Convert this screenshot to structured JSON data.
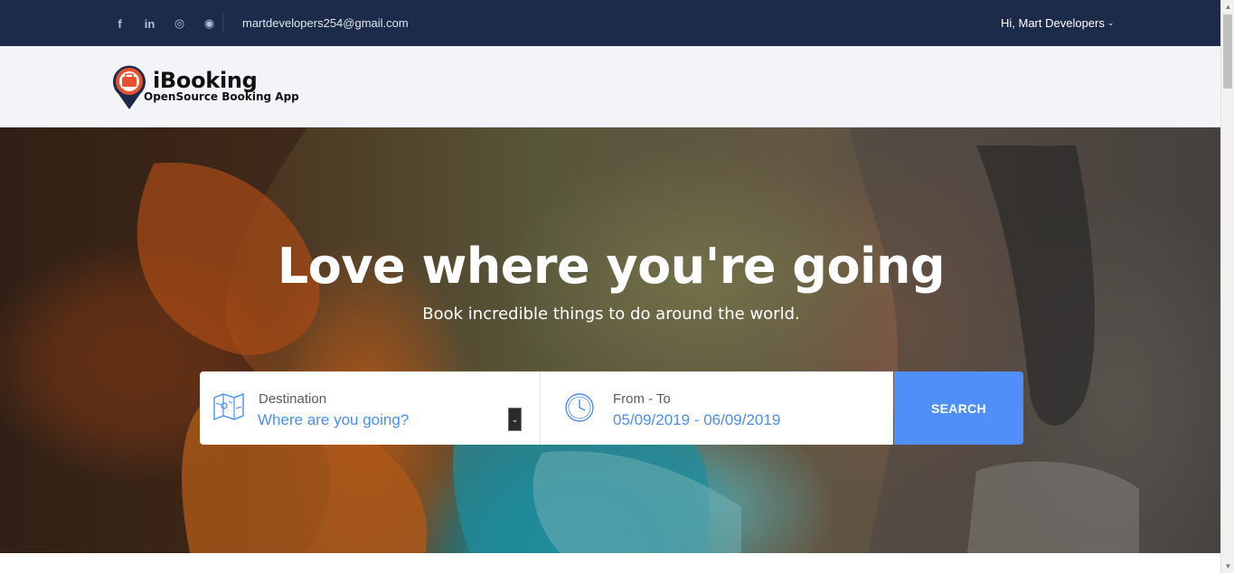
{
  "topbar": {
    "social": [
      {
        "name": "facebook-icon",
        "glyph": "f"
      },
      {
        "name": "linkedin-icon",
        "glyph": "in"
      },
      {
        "name": "instagram-icon",
        "glyph": "◎"
      },
      {
        "name": "github-icon",
        "glyph": "◉"
      }
    ],
    "email": "martdevelopers254@gmail.com",
    "user_greeting": "Hi, Mart Developers",
    "user_chevron": "⌄"
  },
  "header": {
    "logo_name": "iBooking",
    "logo_tagline": "OpenSource Booking App"
  },
  "hero": {
    "title": "Love where you're going",
    "subtitle": "Book incredible things to do around the world."
  },
  "search": {
    "destination_label": "Destination",
    "destination_value": "Where are you going?",
    "destination_arrow": "⌄",
    "date_label": "From - To",
    "date_value": "05/09/2019 - 06/09/2019",
    "button_label": "SEARCH"
  },
  "scrollbar": {
    "up": "▲",
    "down": "▼"
  },
  "colors": {
    "topbar_bg": "#1c2b4a",
    "header_bg": "#f2f4f8",
    "accent": "#4f8ff7",
    "link_text": "#4a8ff0",
    "logo_pin_red": "#e8502f",
    "logo_pin_navy": "#1c2b4a"
  }
}
